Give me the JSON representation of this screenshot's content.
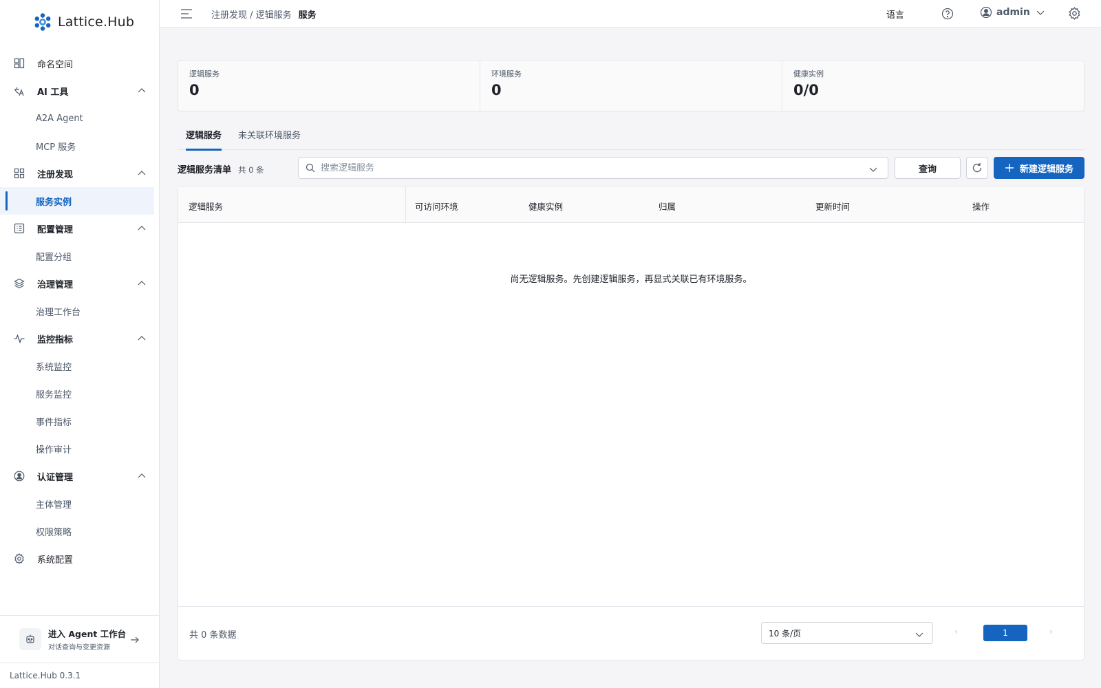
{
  "brand": {
    "name": "Lattice.Hub",
    "version": "Lattice.Hub 0.3.1"
  },
  "sidebar": {
    "items": [
      {
        "label": "命名空间"
      },
      {
        "label": "AI 工具"
      },
      {
        "label": "A2A Agent"
      },
      {
        "label": "MCP 服务"
      },
      {
        "label": "注册发现"
      },
      {
        "label": "服务实例"
      },
      {
        "label": "配置管理"
      },
      {
        "label": "配置分组"
      },
      {
        "label": "治理管理"
      },
      {
        "label": "治理工作台"
      },
      {
        "label": "监控指标"
      },
      {
        "label": "系统监控"
      },
      {
        "label": "服务监控"
      },
      {
        "label": "事件指标"
      },
      {
        "label": "操作审计"
      },
      {
        "label": "认证管理"
      },
      {
        "label": "主体管理"
      },
      {
        "label": "权限策略"
      },
      {
        "label": "系统配置"
      }
    ],
    "agent_entry": {
      "title": "进入 Agent 工作台",
      "subtitle": "对话查询与变更资源"
    }
  },
  "header": {
    "breadcrumb_parent": "注册发现 / 逻辑服务",
    "breadcrumb_current": "服务",
    "language": "语言",
    "user": "admin"
  },
  "stats": [
    {
      "label": "逻辑服务",
      "value": "0"
    },
    {
      "label": "环境服务",
      "value": "0"
    },
    {
      "label": "健康实例",
      "value": "0/0"
    }
  ],
  "tabs": [
    {
      "label": "逻辑服务"
    },
    {
      "label": "未关联环境服务"
    }
  ],
  "toolbar": {
    "title": "逻辑服务清单",
    "count": "共 0 条",
    "search_placeholder": "搜索逻辑服务",
    "query_label": "查询",
    "new_label": "新建逻辑服务"
  },
  "table": {
    "columns": [
      "逻辑服务",
      "可访问环境",
      "健康实例",
      "归属",
      "更新时间",
      "操作"
    ],
    "rows": [],
    "empty_text": "尚无逻辑服务。先创建逻辑服务，再显式关联已有环境服务。"
  },
  "pagination": {
    "total": "共 0 条数据",
    "page_size": "10 条/页",
    "prev": "‹",
    "current_page": "1",
    "next": "›"
  },
  "colors": {
    "primary": "#1565c0",
    "active_bg": "#eef3fc",
    "border": "#e5e6eb"
  },
  "icons": {
    "sidebar": [
      "namespace-icon",
      "ai-tool-icon",
      "registry-icon",
      "config-icon",
      "governance-icon",
      "monitor-icon",
      "auth-icon",
      "gear-icon"
    ],
    "header": [
      "menu-icon",
      "help-icon",
      "user-icon",
      "chevron-down-icon",
      "gear-icon"
    ]
  }
}
